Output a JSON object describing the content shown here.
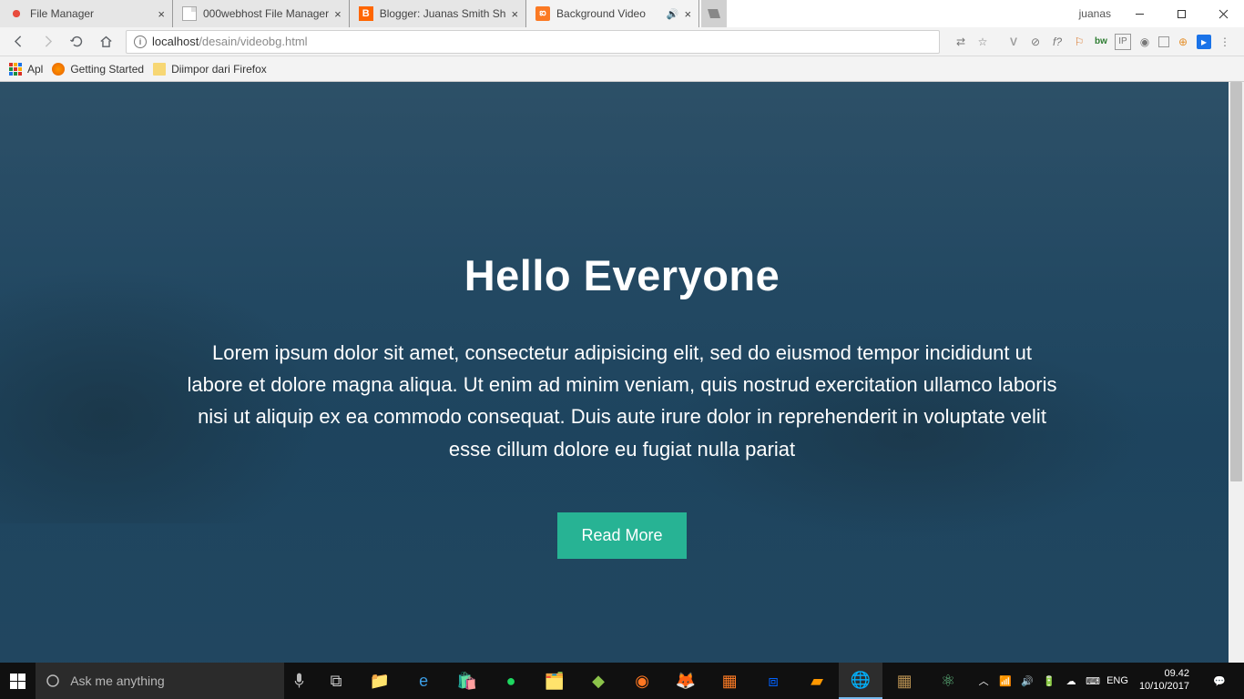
{
  "window": {
    "user": "juanas"
  },
  "tabs": [
    {
      "title": "File Manager",
      "favicon": "filemanager"
    },
    {
      "title": "000webhost File Manager",
      "favicon": "doc"
    },
    {
      "title": "Blogger: Juanas Smith Sh",
      "favicon": "blogger"
    },
    {
      "title": "Background Video",
      "favicon": "xampp",
      "audio": true,
      "active": true
    }
  ],
  "address": {
    "host": "localhost",
    "path": "/desain/videobg.html"
  },
  "bookmarks": [
    {
      "label": "Apl",
      "icon": "apps"
    },
    {
      "label": "Getting Started",
      "icon": "firefox"
    },
    {
      "label": "Diimpor dari Firefox",
      "icon": "folder"
    }
  ],
  "page": {
    "heading": "Hello Everyone",
    "paragraph": "Lorem ipsum dolor sit amet, consectetur adipisicing elit, sed do eiusmod tempor incididunt ut labore et dolore magna aliqua. Ut enim ad minim veniam, quis nostrud exercitation ullamco laboris nisi ut aliquip ex ea commodo consequat. Duis aute irure dolor in reprehenderit in voluptate velit esse cillum dolore eu fugiat nulla pariat",
    "button": "Read More"
  },
  "taskbar": {
    "search_placeholder": "Ask me anything",
    "lang": "ENG",
    "time": "09.42",
    "date": "10/10/2017"
  }
}
